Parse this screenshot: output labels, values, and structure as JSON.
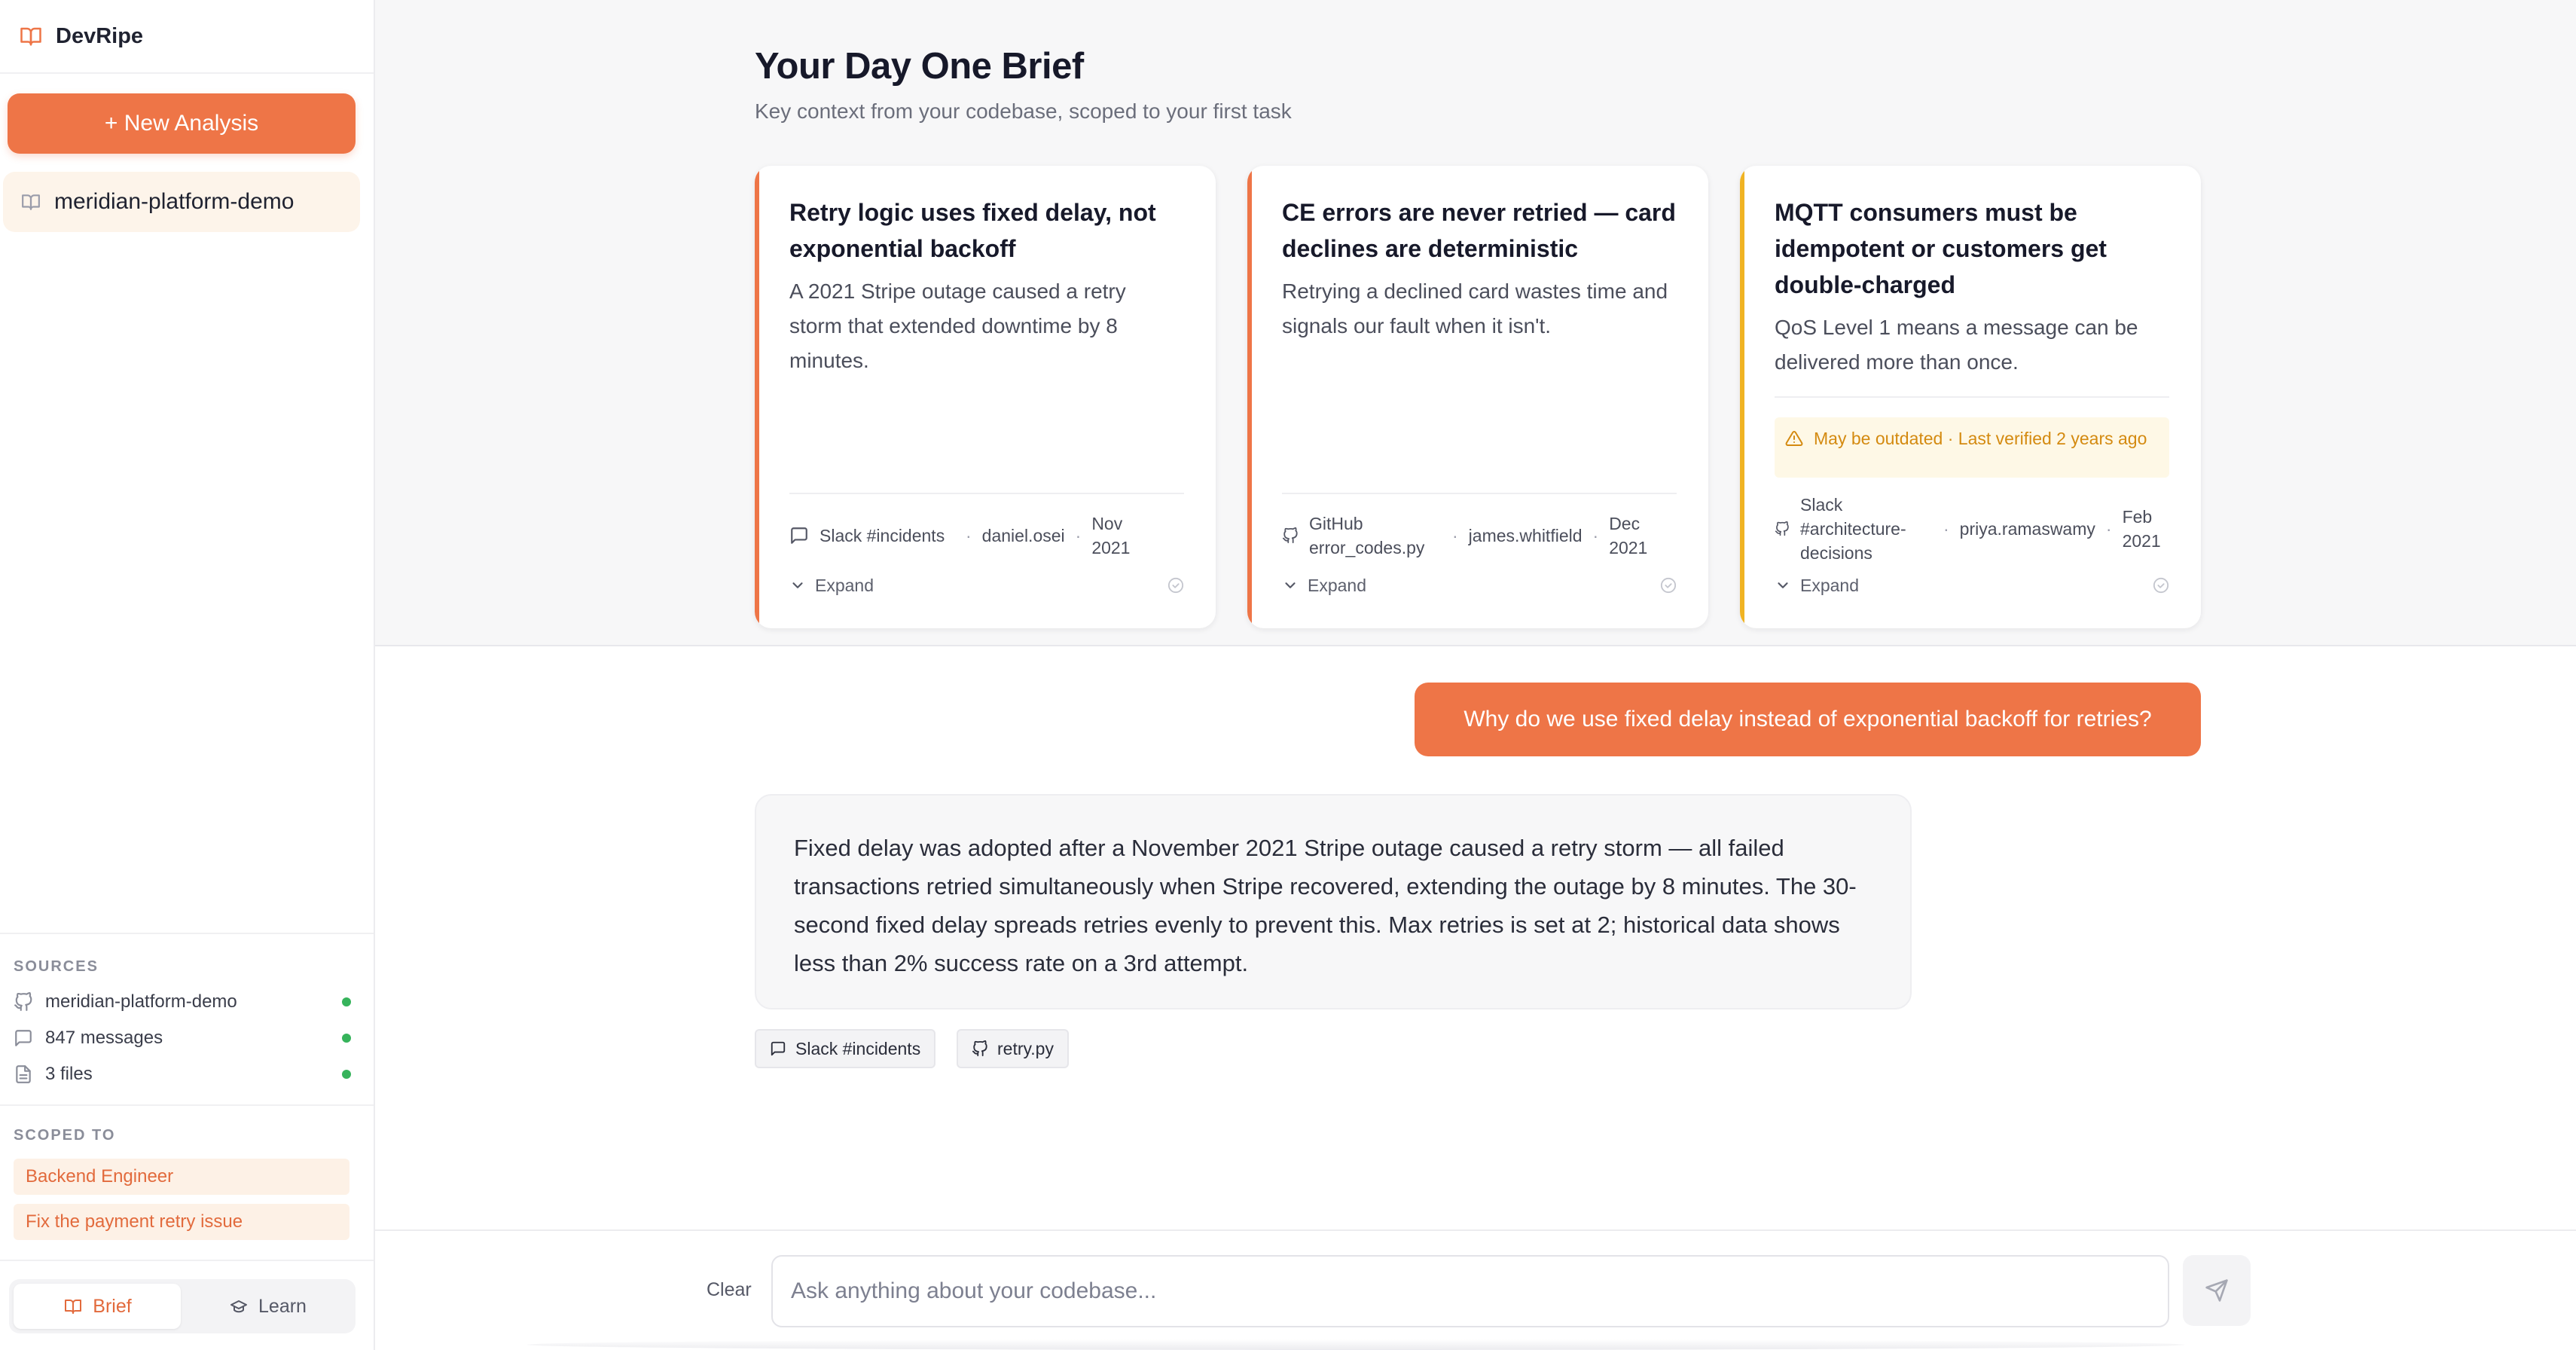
{
  "app": {
    "name": "DevRipe",
    "brand_color": "#ee7547",
    "icon": "book-open-icon"
  },
  "sidebar": {
    "new_analysis_label": "+ New Analysis",
    "project": {
      "label": "meridian-platform-demo",
      "icon": "book-open-icon"
    },
    "sources": {
      "title": "SOURCES",
      "items": [
        {
          "label": "meridian-platform-demo",
          "icon": "github-icon",
          "status": "connected"
        },
        {
          "label": "847 messages",
          "icon": "message-square-icon",
          "status": "connected"
        },
        {
          "label": "3 files",
          "icon": "file-text-icon",
          "status": "connected"
        }
      ]
    },
    "scoped_to": {
      "title": "SCOPED TO",
      "role": "Backend Engineer",
      "task": "Fix the payment retry issue"
    },
    "modes": [
      {
        "label": "Brief",
        "icon": "book-open-icon",
        "active": true
      },
      {
        "label": "Learn",
        "icon": "graduation-cap-icon",
        "active": false
      }
    ]
  },
  "brief": {
    "title": "Your Day One Brief",
    "subtitle": "Key context from your codebase, scoped to your first task",
    "expand_label": "Expand",
    "cards": [
      {
        "title": "Retry logic uses fixed delay, not exponential backoff",
        "description": "A 2021 Stripe outage caused a retry storm that extended downtime by 8 minutes.",
        "accent": "#ee7547",
        "source_icon": "message-square-icon",
        "source": "Slack #incidents",
        "author": "daniel.osei",
        "date": "Nov 2021"
      },
      {
        "title": "CE errors are never retried — card declines are deterministic",
        "description": "Retrying a declined card wastes time and signals our fault when it isn't.",
        "accent": "#ee7547",
        "source_icon": "github-icon",
        "source": "GitHub error_codes.py",
        "author": "james.whitfield",
        "date": "Dec 2021"
      },
      {
        "title": "MQTT consumers must be idempotent or customers get double-charged",
        "description": "QoS Level 1 means a message can be delivered more than once.",
        "accent": "#f0b323",
        "warning": "May be outdated · Last verified 2 years ago",
        "source_icon": "github-icon",
        "source": "Slack #architecture-decisions",
        "author": "priya.ramaswamy",
        "date": "Feb 2021"
      }
    ]
  },
  "chat": {
    "user_message": "Why do we use fixed delay instead of exponential backoff for retries?",
    "assistant_message": "Fixed delay was adopted after a November 2021 Stripe outage caused a retry storm — all failed transactions retried simultaneously when Stripe recovered, extending the outage by 8 minutes. The 30-second fixed delay spreads retries evenly to prevent this. Max retries is set at 2; historical data shows less than 2% success rate on a 3rd attempt.",
    "citations": [
      {
        "label": "Slack #incidents",
        "icon": "message-square-icon"
      },
      {
        "label": "retry.py",
        "icon": "github-icon"
      }
    ],
    "clear_label": "Clear",
    "input_placeholder": "Ask anything about your codebase...",
    "input_value": ""
  }
}
